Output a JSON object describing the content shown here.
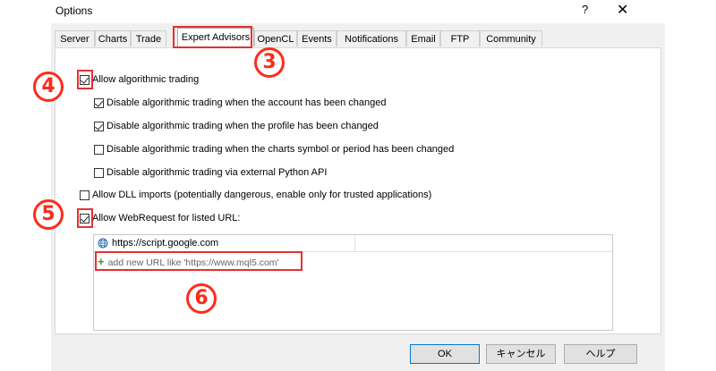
{
  "window": {
    "title": "Options",
    "help_glyph": "?",
    "close_glyph": "✕"
  },
  "tabs": [
    {
      "label": "Server"
    },
    {
      "label": "Charts"
    },
    {
      "label": "Trade"
    },
    {
      "label": "Expert Advisors",
      "active": true
    },
    {
      "label": "OpenCL"
    },
    {
      "label": "Events"
    },
    {
      "label": "Notifications"
    },
    {
      "label": "Email"
    },
    {
      "label": "FTP"
    },
    {
      "label": "Community"
    }
  ],
  "options": {
    "allow_algo": {
      "label": "Allow algorithmic trading",
      "checked": true
    },
    "disable_account": {
      "label": "Disable algorithmic trading when the account has been changed",
      "checked": true
    },
    "disable_profile": {
      "label": "Disable algorithmic trading when the profile has been changed",
      "checked": true
    },
    "disable_symbol": {
      "label": "Disable algorithmic trading when the charts symbol or period has been changed",
      "checked": false
    },
    "disable_python": {
      "label": "Disable algorithmic trading via external Python API",
      "checked": false
    },
    "allow_dll": {
      "label": "Allow DLL imports (potentially dangerous, enable only for trusted applications)",
      "checked": false
    },
    "allow_webrequest": {
      "label": "Allow WebRequest for listed URL:",
      "checked": true
    }
  },
  "url_list": {
    "items": [
      {
        "url": "https://script.google.com",
        "icon": "globe-icon"
      }
    ],
    "add_hint": "add new URL like 'https://www.mql5.com'"
  },
  "buttons": {
    "ok": "OK",
    "cancel": "キャンセル",
    "help": "ヘルプ"
  },
  "annotations": {
    "m3": "3",
    "m4": "4",
    "m5": "5",
    "m6": "6",
    "color": "#ff2a1a"
  }
}
